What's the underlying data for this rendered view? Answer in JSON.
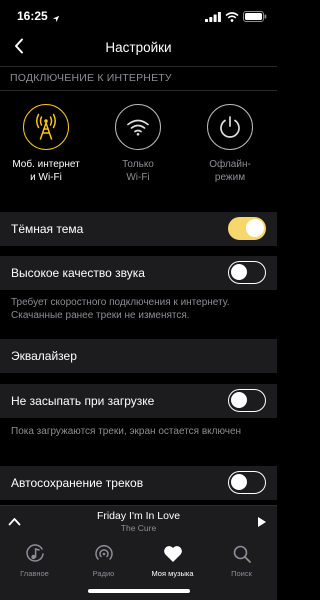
{
  "status_bar": {
    "time": "16:25",
    "location_icon": "location-arrow-icon",
    "signal_icon": "cellular-signal-icon",
    "wifi_icon": "wifi-icon",
    "battery_icon": "battery-icon"
  },
  "header": {
    "title": "Настройки",
    "back_icon": "chevron-left-icon"
  },
  "connection": {
    "section_label": "ПОДКЛЮЧЕНИЕ К ИНТЕРНЕТУ",
    "options": [
      {
        "label_line1": "Моб. интернет",
        "label_line2": "и Wi-Fi",
        "icon": "cell-tower-icon",
        "selected": true
      },
      {
        "label_line1": "Только",
        "label_line2": "Wi-Fi",
        "icon": "wifi-icon",
        "selected": false
      },
      {
        "label_line1": "Офлайн-",
        "label_line2": "режим",
        "icon": "power-icon",
        "selected": false
      }
    ]
  },
  "settings": {
    "dark_theme": {
      "label": "Тёмная тема",
      "enabled": true
    },
    "high_quality": {
      "label": "Высокое качество звука",
      "enabled": false,
      "note": "Требует скоростного подключения к интернету. Скачанные ранее треки не изменятся."
    },
    "equalizer": {
      "label": "Эквалайзер"
    },
    "no_sleep": {
      "label": "Не засыпать при загрузке",
      "enabled": false,
      "note": "Пока загружаются треки, экран остается включен"
    },
    "autosave": {
      "label": "Автосохранение треков",
      "enabled": false
    }
  },
  "player": {
    "song": "Friday I'm In Love",
    "artist": "The Cure",
    "expand_icon": "chevron-up-icon",
    "play_icon": "play-icon"
  },
  "tabs": [
    {
      "label": "Главное",
      "icon": "music-note-icon",
      "active": false
    },
    {
      "label": "Радио",
      "icon": "radio-icon",
      "active": false
    },
    {
      "label": "Моя музыка",
      "icon": "heart-icon",
      "active": true
    },
    {
      "label": "Поиск",
      "icon": "search-icon",
      "active": false
    }
  ],
  "colors": {
    "accent": "#f5c518",
    "toggle_on": "#f5d76e",
    "background": "#000000",
    "row_background": "#1c1c1e",
    "secondary_text": "#8e8e93"
  }
}
